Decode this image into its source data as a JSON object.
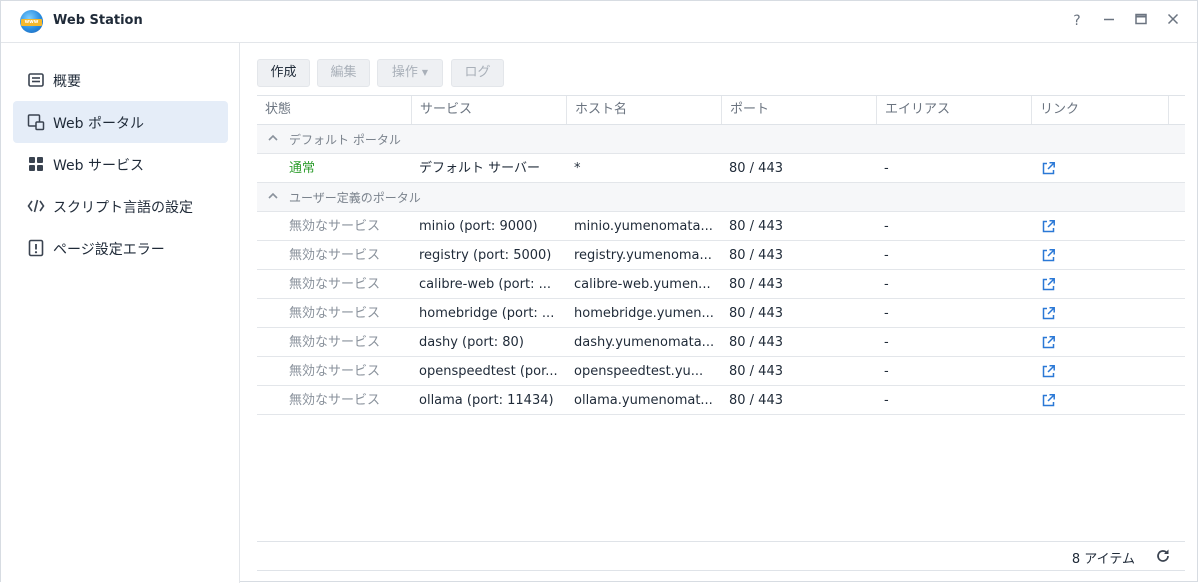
{
  "window": {
    "title": "Web Station",
    "logo_text": "www",
    "help_label": "?",
    "minimize_label": "—",
    "maximize_label": "▭",
    "close_label": "✕"
  },
  "sidebar": {
    "items": [
      {
        "label": "概要",
        "icon": "overview-icon",
        "active": false
      },
      {
        "label": "Web ポータル",
        "icon": "web-portal-icon",
        "active": true
      },
      {
        "label": "Web サービス",
        "icon": "web-service-icon",
        "active": false
      },
      {
        "label": "スクリプト言語の設定",
        "icon": "code-icon",
        "active": false
      },
      {
        "label": "ページ設定エラー",
        "icon": "alert-icon",
        "active": false
      }
    ]
  },
  "toolbar": {
    "create_label": "作成",
    "edit_label": "編集",
    "action_label": "操作",
    "log_label": "ログ"
  },
  "grid": {
    "columns": [
      "状態",
      "サービス",
      "ホスト名",
      "ポート",
      "エイリアス",
      "リンク"
    ],
    "groups": [
      {
        "label": "デフォルト ポータル",
        "rows": [
          {
            "status": "通常",
            "status_kind": "normal",
            "service": "デフォルト サーバー",
            "host": "*",
            "port": "80 / 443",
            "alias": "-"
          }
        ]
      },
      {
        "label": "ユーザー定義のポータル",
        "rows": [
          {
            "status": "無効なサービス",
            "status_kind": "disabled",
            "service": "minio (port: 9000)",
            "host": "minio.yumenomata...",
            "port": "80 / 443",
            "alias": "-"
          },
          {
            "status": "無効なサービス",
            "status_kind": "disabled",
            "service": "registry (port: 5000)",
            "host": "registry.yumenoma...",
            "port": "80 / 443",
            "alias": "-"
          },
          {
            "status": "無効なサービス",
            "status_kind": "disabled",
            "service": "calibre-web (port: ...",
            "host": "calibre-web.yumen...",
            "port": "80 / 443",
            "alias": "-"
          },
          {
            "status": "無効なサービス",
            "status_kind": "disabled",
            "service": "homebridge (port: ...",
            "host": "homebridge.yumen...",
            "port": "80 / 443",
            "alias": "-"
          },
          {
            "status": "無効なサービス",
            "status_kind": "disabled",
            "service": "dashy (port: 80)",
            "host": "dashy.yumenomata...",
            "port": "80 / 443",
            "alias": "-"
          },
          {
            "status": "無効なサービス",
            "status_kind": "disabled",
            "service": "openspeedtest (por...",
            "host": "openspeedtest.yu...",
            "port": "80 / 443",
            "alias": "-"
          },
          {
            "status": "無効なサービス",
            "status_kind": "disabled",
            "service": "ollama (port: 11434)",
            "host": "ollama.yumenomat...",
            "port": "80 / 443",
            "alias": "-"
          }
        ]
      }
    ],
    "footer": {
      "item_count": "8 アイテム"
    }
  },
  "colors": {
    "accent": "#2a78d6",
    "status_normal": "#2f9e2f",
    "status_disabled": "#8a929c",
    "sidebar_active_bg": "#e5edf8"
  }
}
